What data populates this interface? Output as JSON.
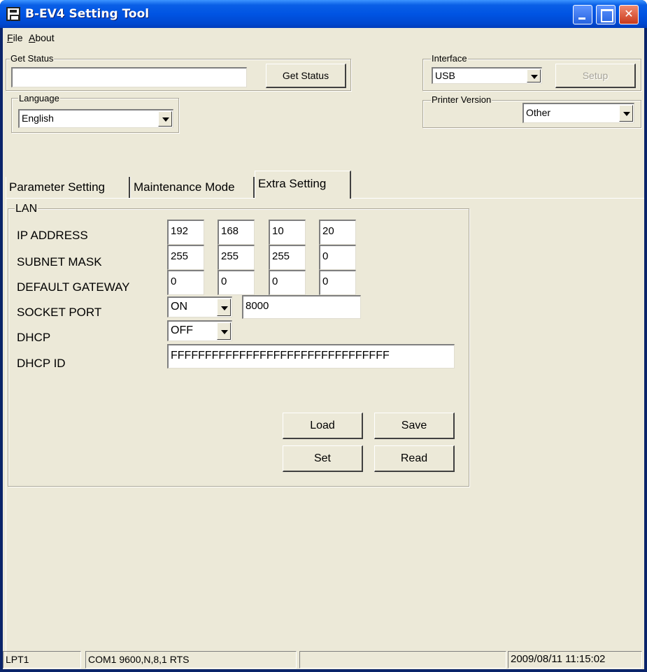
{
  "window": {
    "title": "B-EV4 Setting Tool"
  },
  "menu": {
    "file": {
      "prefix": "",
      "accel": "F",
      "rest": "ile"
    },
    "about": {
      "prefix": "",
      "accel": "A",
      "rest": "bout"
    }
  },
  "get_status": {
    "group_label": "Get Status",
    "value": "",
    "button_label": "Get Status"
  },
  "language": {
    "group_label": "Language",
    "selected": "English"
  },
  "interface": {
    "group_label": "Interface",
    "selected": "USB",
    "setup_label": "Setup"
  },
  "printer_version": {
    "group_label": "Printer Version",
    "selected": "Other"
  },
  "tabs": [
    {
      "label": "Parameter Setting"
    },
    {
      "label": "Maintenance Mode"
    },
    {
      "label": "Extra Setting",
      "active": true
    }
  ],
  "lan": {
    "group_label": "LAN",
    "ip_address": {
      "label": "IP ADDRESS",
      "octets": [
        "192",
        "168",
        "10",
        "20"
      ]
    },
    "subnet_mask": {
      "label": "SUBNET MASK",
      "octets": [
        "255",
        "255",
        "255",
        "0"
      ]
    },
    "default_gateway": {
      "label": "DEFAULT GATEWAY",
      "octets": [
        "0",
        "0",
        "0",
        "0"
      ]
    },
    "socket_port": {
      "label": "SOCKET PORT",
      "state": "ON",
      "port": "8000"
    },
    "dhcp": {
      "label": "DHCP",
      "state": "OFF"
    },
    "dhcp_id": {
      "label": "DHCP ID",
      "value": "FFFFFFFFFFFFFFFFFFFFFFFFFFFFFFFF"
    },
    "buttons": {
      "load": "Load",
      "save": "Save",
      "set": "Set",
      "read": "Read"
    }
  },
  "statusbar": {
    "port": "LPT1",
    "com": "COM1 9600,N,8,1 RTS",
    "middle": "",
    "datetime": "2009/08/11 11:15:02"
  }
}
